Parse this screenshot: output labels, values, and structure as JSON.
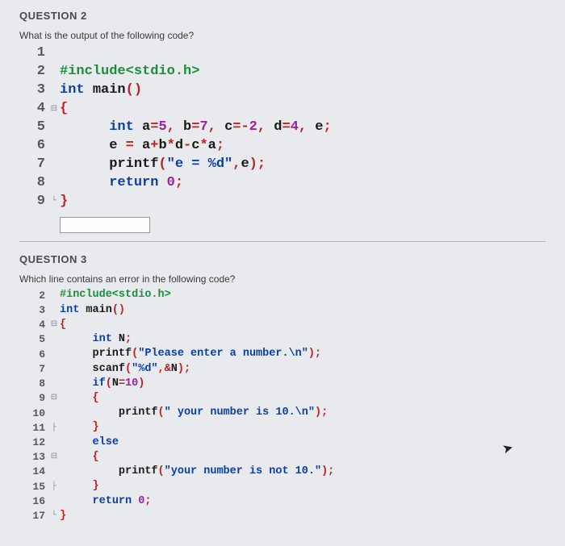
{
  "q2": {
    "title": "QUESTION 2",
    "prompt": "What is the output of the following code?",
    "lines": [
      {
        "n": "1",
        "fold": "",
        "tokens": []
      },
      {
        "n": "2",
        "fold": "",
        "tokens": [
          {
            "t": "#include<stdio.h>",
            "c": "kw-pre"
          }
        ]
      },
      {
        "n": "3",
        "fold": "",
        "tokens": [
          {
            "t": "int ",
            "c": "kw-blue"
          },
          {
            "t": "main",
            "c": "ident"
          },
          {
            "t": "()",
            "c": "op-red"
          }
        ]
      },
      {
        "n": "4",
        "fold": "⊟",
        "tokens": [
          {
            "t": "{",
            "c": "op-red"
          }
        ]
      },
      {
        "n": "5",
        "fold": "",
        "tokens": [
          {
            "t": "      ",
            "c": "plain"
          },
          {
            "t": "int ",
            "c": "kw-blue"
          },
          {
            "t": "a",
            "c": "ident"
          },
          {
            "t": "=",
            "c": "op-red"
          },
          {
            "t": "5",
            "c": "num-purple"
          },
          {
            "t": ", ",
            "c": "op-red"
          },
          {
            "t": "b",
            "c": "ident"
          },
          {
            "t": "=",
            "c": "op-red"
          },
          {
            "t": "7",
            "c": "num-purple"
          },
          {
            "t": ", ",
            "c": "op-red"
          },
          {
            "t": "c",
            "c": "ident"
          },
          {
            "t": "=-",
            "c": "op-red"
          },
          {
            "t": "2",
            "c": "num-purple"
          },
          {
            "t": ", ",
            "c": "op-red"
          },
          {
            "t": "d",
            "c": "ident"
          },
          {
            "t": "=",
            "c": "op-red"
          },
          {
            "t": "4",
            "c": "num-purple"
          },
          {
            "t": ", ",
            "c": "op-red"
          },
          {
            "t": "e",
            "c": "ident"
          },
          {
            "t": ";",
            "c": "op-red"
          }
        ]
      },
      {
        "n": "6",
        "fold": "",
        "tokens": [
          {
            "t": "      e ",
            "c": "ident"
          },
          {
            "t": "= ",
            "c": "op-red"
          },
          {
            "t": "a",
            "c": "ident"
          },
          {
            "t": "+",
            "c": "op-red"
          },
          {
            "t": "b",
            "c": "ident"
          },
          {
            "t": "*",
            "c": "op-red"
          },
          {
            "t": "d",
            "c": "ident"
          },
          {
            "t": "-",
            "c": "op-red"
          },
          {
            "t": "c",
            "c": "ident"
          },
          {
            "t": "*",
            "c": "op-red"
          },
          {
            "t": "a",
            "c": "ident"
          },
          {
            "t": ";",
            "c": "op-red"
          }
        ]
      },
      {
        "n": "7",
        "fold": "",
        "tokens": [
          {
            "t": "      printf",
            "c": "ident"
          },
          {
            "t": "(",
            "c": "op-red"
          },
          {
            "t": "\"e = %d\"",
            "c": "str-blue"
          },
          {
            "t": ",",
            "c": "op-red"
          },
          {
            "t": "e",
            "c": "ident"
          },
          {
            "t": ");",
            "c": "op-red"
          }
        ]
      },
      {
        "n": "8",
        "fold": "",
        "tokens": [
          {
            "t": "      ",
            "c": "plain"
          },
          {
            "t": "return ",
            "c": "kw-blue"
          },
          {
            "t": "0",
            "c": "num-purple"
          },
          {
            "t": ";",
            "c": "op-red"
          }
        ]
      },
      {
        "n": "9",
        "fold": "└",
        "tokens": [
          {
            "t": "}",
            "c": "op-red"
          }
        ]
      }
    ]
  },
  "q3": {
    "title": "QUESTION 3",
    "prompt": "Which line contains an error in the following code?",
    "lines": [
      {
        "n": "2",
        "fold": "",
        "tokens": [
          {
            "t": "#include<stdio.h>",
            "c": "kw-pre"
          }
        ]
      },
      {
        "n": "3",
        "fold": "",
        "tokens": [
          {
            "t": "int ",
            "c": "kw-blue"
          },
          {
            "t": "main",
            "c": "ident"
          },
          {
            "t": "()",
            "c": "op-red"
          }
        ]
      },
      {
        "n": "4",
        "fold": "⊟",
        "tokens": [
          {
            "t": "{",
            "c": "op-red"
          }
        ]
      },
      {
        "n": "5",
        "fold": "",
        "tokens": [
          {
            "t": "     ",
            "c": "plain"
          },
          {
            "t": "int ",
            "c": "kw-blue"
          },
          {
            "t": "N",
            "c": "ident"
          },
          {
            "t": ";",
            "c": "op-red"
          }
        ]
      },
      {
        "n": "6",
        "fold": "",
        "tokens": [
          {
            "t": "     printf",
            "c": "ident"
          },
          {
            "t": "(",
            "c": "op-red"
          },
          {
            "t": "\"Please enter a number.\\n\"",
            "c": "str-blue"
          },
          {
            "t": ");",
            "c": "op-red"
          }
        ]
      },
      {
        "n": "7",
        "fold": "",
        "tokens": [
          {
            "t": "     scanf",
            "c": "ident"
          },
          {
            "t": "(",
            "c": "op-red"
          },
          {
            "t": "\"%d\"",
            "c": "str-blue"
          },
          {
            "t": ",&",
            "c": "op-red"
          },
          {
            "t": "N",
            "c": "ident"
          },
          {
            "t": ");",
            "c": "op-red"
          }
        ]
      },
      {
        "n": "8",
        "fold": "",
        "tokens": [
          {
            "t": "     ",
            "c": "plain"
          },
          {
            "t": "if",
            "c": "kw-blue"
          },
          {
            "t": "(",
            "c": "op-red"
          },
          {
            "t": "N",
            "c": "ident"
          },
          {
            "t": "=",
            "c": "op-red"
          },
          {
            "t": "10",
            "c": "num-purple"
          },
          {
            "t": ")",
            "c": "op-red"
          }
        ]
      },
      {
        "n": "9",
        "fold": "⊟",
        "tokens": [
          {
            "t": "     ",
            "c": "plain"
          },
          {
            "t": "{",
            "c": "op-red"
          }
        ]
      },
      {
        "n": "10",
        "fold": "",
        "tokens": [
          {
            "t": "         printf",
            "c": "ident"
          },
          {
            "t": "(",
            "c": "op-red"
          },
          {
            "t": "\" your number is 10.\\n\"",
            "c": "str-blue"
          },
          {
            "t": ");",
            "c": "op-red"
          }
        ]
      },
      {
        "n": "11",
        "fold": "├",
        "tokens": [
          {
            "t": "     ",
            "c": "plain"
          },
          {
            "t": "}",
            "c": "op-red"
          }
        ]
      },
      {
        "n": "12",
        "fold": "",
        "tokens": [
          {
            "t": "     ",
            "c": "plain"
          },
          {
            "t": "else",
            "c": "kw-blue"
          }
        ]
      },
      {
        "n": "13",
        "fold": "⊟",
        "tokens": [
          {
            "t": "     ",
            "c": "plain"
          },
          {
            "t": "{",
            "c": "op-red"
          }
        ]
      },
      {
        "n": "14",
        "fold": "",
        "tokens": [
          {
            "t": "         printf",
            "c": "ident"
          },
          {
            "t": "(",
            "c": "op-red"
          },
          {
            "t": "\"your number is not 10.\"",
            "c": "str-blue"
          },
          {
            "t": ");",
            "c": "op-red"
          }
        ]
      },
      {
        "n": "15",
        "fold": "├",
        "tokens": [
          {
            "t": "     ",
            "c": "plain"
          },
          {
            "t": "}",
            "c": "op-red"
          }
        ]
      },
      {
        "n": "16",
        "fold": "",
        "tokens": [
          {
            "t": "     ",
            "c": "plain"
          },
          {
            "t": "return ",
            "c": "kw-blue"
          },
          {
            "t": "0",
            "c": "num-purple"
          },
          {
            "t": ";",
            "c": "op-red"
          }
        ]
      },
      {
        "n": "17",
        "fold": "└",
        "tokens": [
          {
            "t": "}",
            "c": "op-red"
          }
        ]
      }
    ]
  }
}
